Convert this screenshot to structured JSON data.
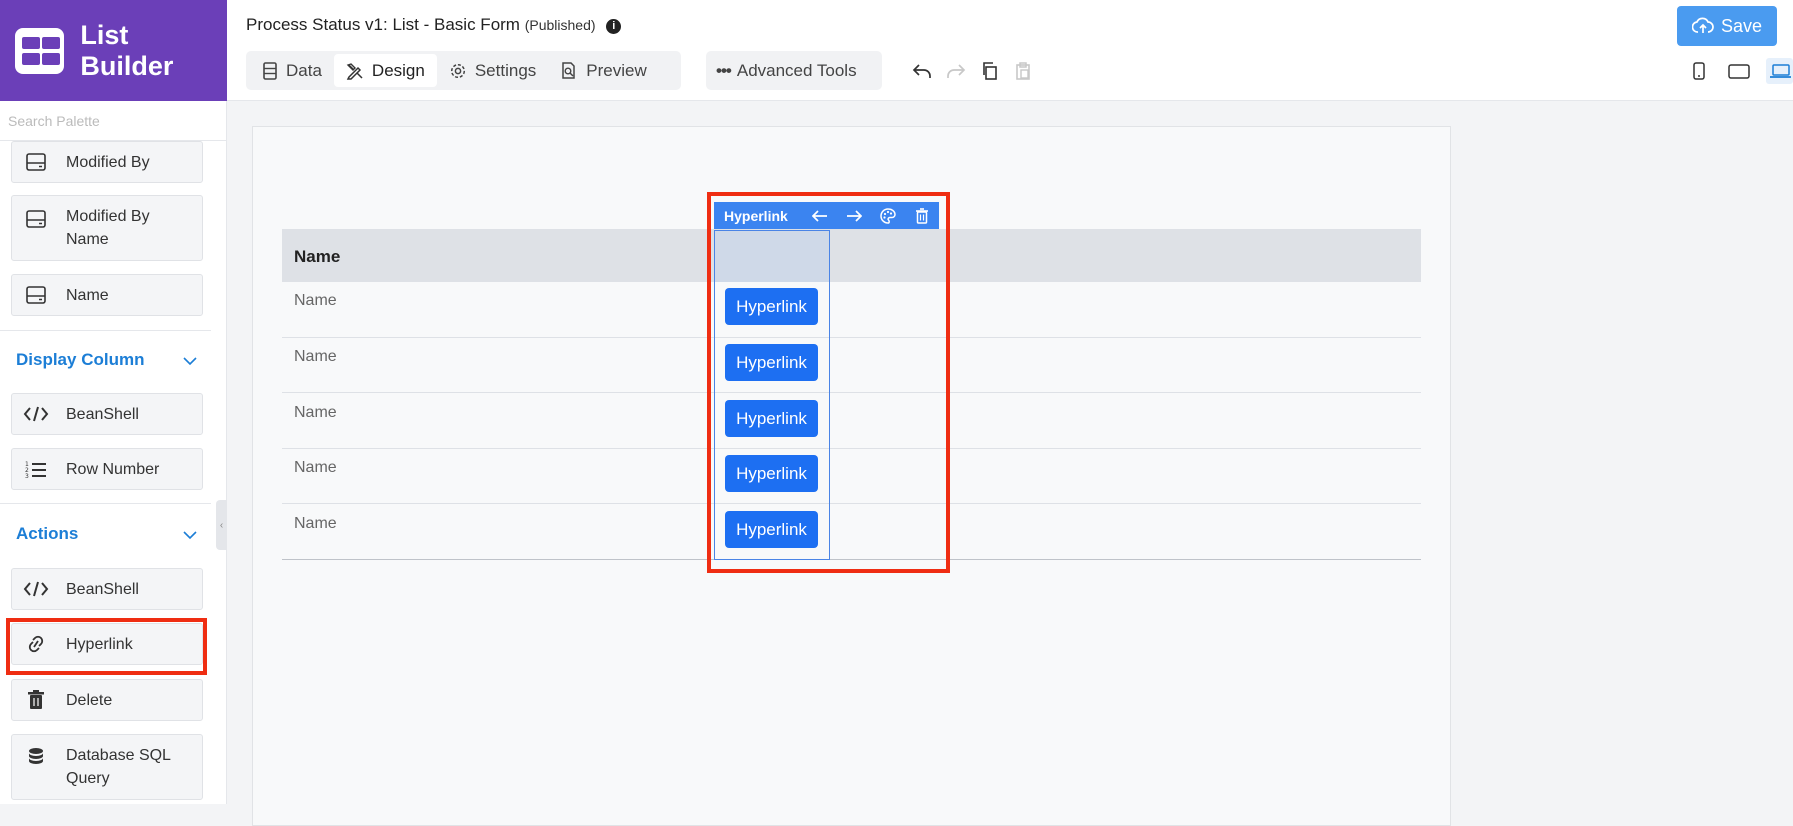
{
  "app": {
    "title": "List Builder",
    "accent_color": "#6b3fb8"
  },
  "header": {
    "process_title": "Process Status v1: List - Basic Form",
    "status": "(Published)",
    "info_icon": "info-icon",
    "tabs": [
      {
        "label": "Data",
        "icon": "table-icon",
        "active": false
      },
      {
        "label": "Design",
        "icon": "design-tools-icon",
        "active": true
      },
      {
        "label": "Settings",
        "icon": "gear-icon",
        "active": false
      },
      {
        "label": "Preview",
        "icon": "preview-icon",
        "active": false
      }
    ],
    "advanced_tools": "Advanced Tools",
    "toolbar_icons": [
      "undo-icon",
      "redo-icon",
      "copy-icon",
      "paste-icon"
    ],
    "save_label": "Save",
    "save_color": "#4a9bf0",
    "device_icons": [
      "phone-icon",
      "tablet-icon",
      "laptop-icon"
    ]
  },
  "sidebar": {
    "search_placeholder": "Search Palette",
    "items_top": [
      {
        "label": "Modified By",
        "icon": "field-icon"
      },
      {
        "label": "Modified By Name",
        "icon": "field-icon"
      },
      {
        "label": "Name",
        "icon": "field-icon"
      }
    ],
    "display_column": {
      "title": "Display Column",
      "items": [
        {
          "label": "BeanShell",
          "icon": "code-icon"
        },
        {
          "label": "Row Number",
          "icon": "numbered-list-icon"
        }
      ]
    },
    "actions": {
      "title": "Actions",
      "items": [
        {
          "label": "BeanShell",
          "icon": "code-icon"
        },
        {
          "label": "Hyperlink",
          "icon": "link-icon",
          "highlighted": true
        },
        {
          "label": "Delete",
          "icon": "trash-icon"
        },
        {
          "label": "Database SQL Query",
          "icon": "database-icon"
        }
      ]
    }
  },
  "canvas": {
    "column_header": "Name",
    "rows": [
      "Name",
      "Name",
      "Name",
      "Name",
      "Name"
    ],
    "action_column": {
      "toolbar_title": "Hyperlink",
      "toolbar_icons": [
        "arrow-left-icon",
        "arrow-right-icon",
        "palette-icon",
        "trash-icon"
      ],
      "button_label": "Hyperlink",
      "buttons": [
        "Hyperlink",
        "Hyperlink",
        "Hyperlink",
        "Hyperlink",
        "Hyperlink"
      ]
    },
    "highlight_color": "#ef2d12"
  }
}
